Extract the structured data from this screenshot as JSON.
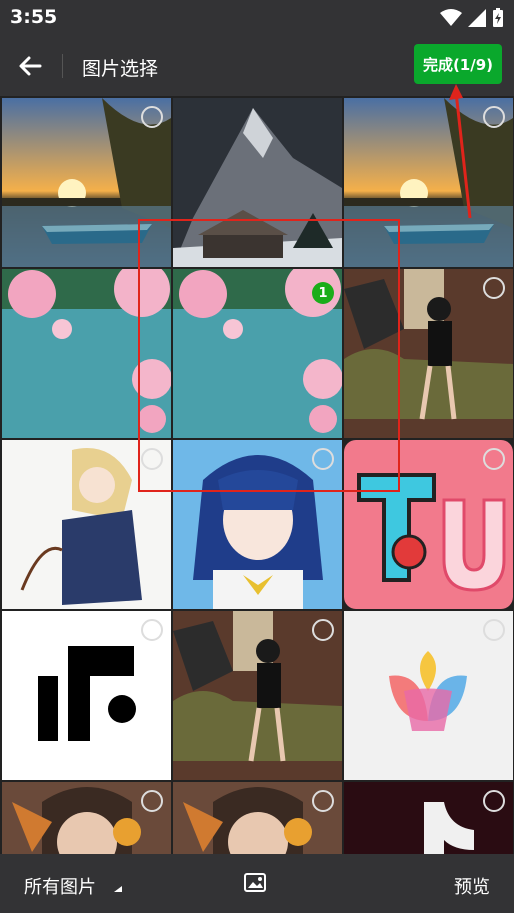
{
  "status_bar": {
    "time": "3:55"
  },
  "header": {
    "title": "图片选择",
    "done_label": "完成(1/9)"
  },
  "grid": {
    "photos": [
      {
        "name": "sunset-lake-boat"
      },
      {
        "name": "snowy-mountain-cabin"
      },
      {
        "name": "sunset-lake-boat-2"
      },
      {
        "name": "cherry-blossom-lake"
      },
      {
        "name": "cherry-blossom-lake-selected",
        "selected_index": "1"
      },
      {
        "name": "woman-on-sofa"
      },
      {
        "name": "anime-girl-umbrella"
      },
      {
        "name": "anime-blue-hair-girl"
      },
      {
        "name": "tu-logo"
      },
      {
        "name": "if-logo"
      },
      {
        "name": "woman-on-sofa-2"
      },
      {
        "name": "tulip-logo"
      },
      {
        "name": "anime-boy-headphones"
      },
      {
        "name": "anime-boy-headphones-2"
      },
      {
        "name": "tiktok-logo"
      }
    ]
  },
  "bottom_bar": {
    "album_label": "所有图片",
    "preview_label": "预览"
  },
  "colors": {
    "accent_green": "#0aa82c",
    "annotation_red": "#e0241b"
  }
}
